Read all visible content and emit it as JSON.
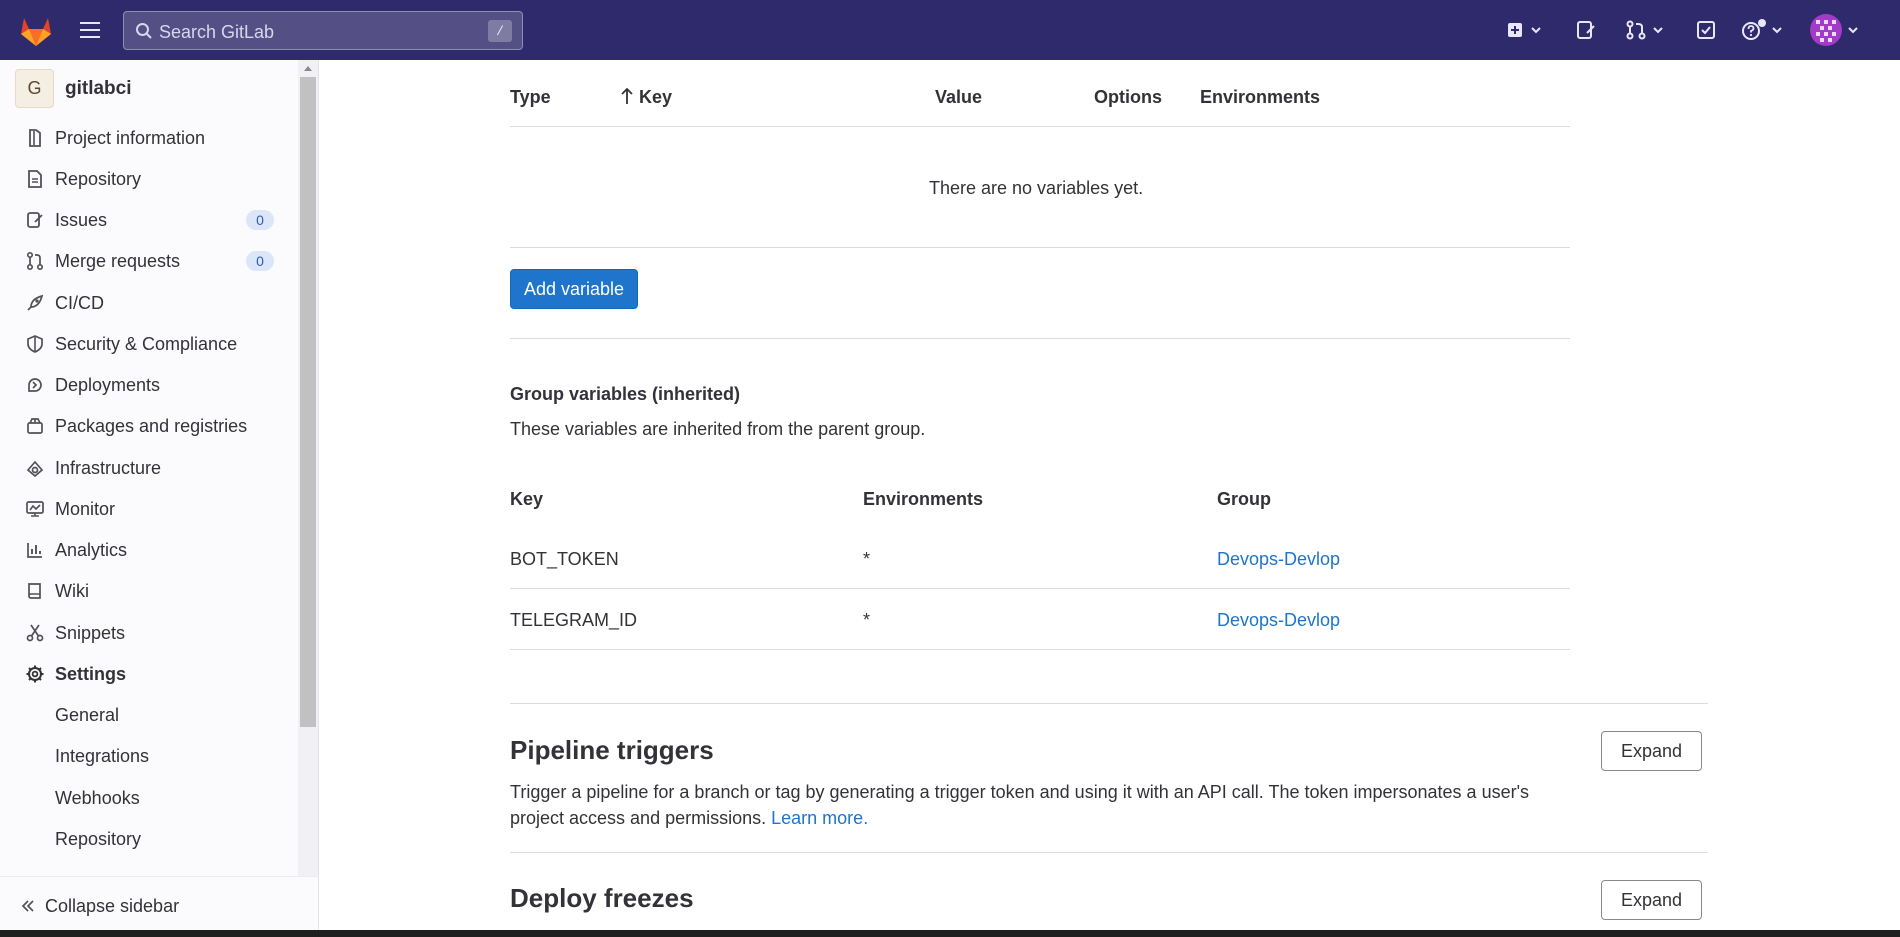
{
  "topbar": {
    "search_placeholder": "Search GitLab",
    "search_shortcut": "/",
    "icons": [
      "gitlab-logo",
      "hamburger-icon",
      "search-icon",
      "plus-square-icon",
      "issues-icon",
      "merge-request-icon",
      "todo-icon",
      "help-icon",
      "avatar"
    ]
  },
  "sidebar": {
    "project_initial": "G",
    "project_name": "gitlabci",
    "items": [
      {
        "label": "Project information",
        "icon": "project-info-icon"
      },
      {
        "label": "Repository",
        "icon": "doc-icon"
      },
      {
        "label": "Issues",
        "icon": "issues-icon",
        "badge": "0"
      },
      {
        "label": "Merge requests",
        "icon": "merge-request-icon",
        "badge": "0"
      },
      {
        "label": "CI/CD",
        "icon": "rocket-icon"
      },
      {
        "label": "Security & Compliance",
        "icon": "shield-icon"
      },
      {
        "label": "Deployments",
        "icon": "deployments-icon"
      },
      {
        "label": "Packages and registries",
        "icon": "package-icon"
      },
      {
        "label": "Infrastructure",
        "icon": "cloud-gear-icon"
      },
      {
        "label": "Monitor",
        "icon": "monitor-icon"
      },
      {
        "label": "Analytics",
        "icon": "chart-icon"
      },
      {
        "label": "Wiki",
        "icon": "book-icon"
      },
      {
        "label": "Snippets",
        "icon": "scissors-icon"
      },
      {
        "label": "Settings",
        "icon": "gear-icon"
      }
    ],
    "settings_sub": [
      "General",
      "Integrations",
      "Webhooks",
      "Repository"
    ],
    "collapse_label": "Collapse sidebar"
  },
  "variables_table": {
    "headers": {
      "type": "Type",
      "key": "Key",
      "value": "Value",
      "options": "Options",
      "environments": "Environments"
    },
    "empty_text": "There are no variables yet.",
    "add_button": "Add variable"
  },
  "group_variables": {
    "title": "Group variables (inherited)",
    "description": "These variables are inherited from the parent group.",
    "headers": {
      "key": "Key",
      "environments": "Environments",
      "group": "Group"
    },
    "rows": [
      {
        "key": "BOT_TOKEN",
        "environments": "*",
        "group": "Devops-Devlop"
      },
      {
        "key": "TELEGRAM_ID",
        "environments": "*",
        "group": "Devops-Devlop"
      }
    ]
  },
  "pipeline_triggers": {
    "title": "Pipeline triggers",
    "description": "Trigger a pipeline for a branch or tag by generating a trigger token and using it with an API call. The token impersonates a user's project access and permissions.",
    "learn_more": "Learn more.",
    "expand": "Expand"
  },
  "deploy_freezes": {
    "title": "Deploy freezes",
    "expand": "Expand"
  }
}
